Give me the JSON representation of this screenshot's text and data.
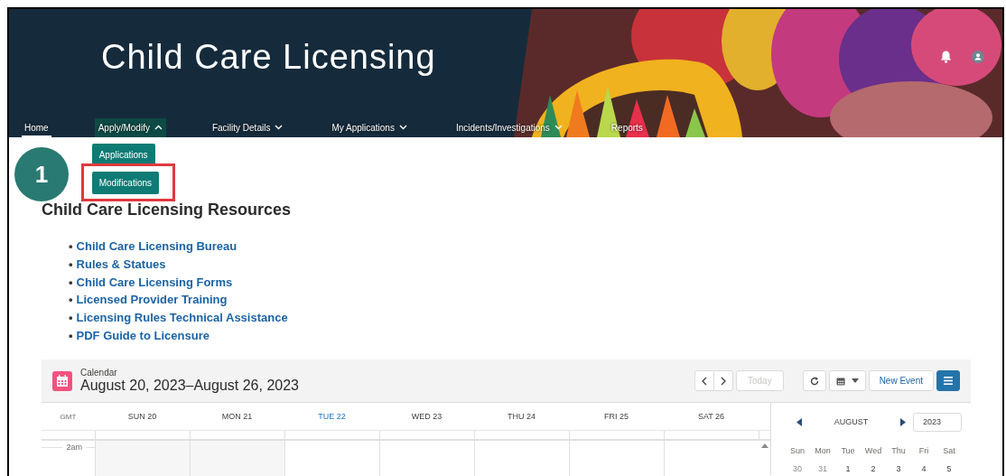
{
  "site_title": "Child Care Licensing",
  "nav": [
    {
      "label": "Home",
      "selected": true,
      "has_menu": false,
      "expanded": false
    },
    {
      "label": "Apply/Modify",
      "selected": false,
      "has_menu": true,
      "expanded": true,
      "menu": [
        {
          "label": "Applications",
          "annotated": false
        },
        {
          "label": "Modifications",
          "annotated": true
        }
      ]
    },
    {
      "label": "Facility Details",
      "selected": false,
      "has_menu": true,
      "expanded": false
    },
    {
      "label": "My Applications",
      "selected": false,
      "has_menu": true,
      "expanded": false
    },
    {
      "label": "Incidents/Investigations",
      "selected": false,
      "has_menu": true,
      "expanded": false
    },
    {
      "label": "Reports",
      "selected": false,
      "has_menu": false,
      "expanded": false
    }
  ],
  "step_badge": "1",
  "resources": {
    "title": "Child Care Licensing Resources",
    "links": [
      {
        "bullet": "•",
        "label": "Child Care Licensing Bureau"
      },
      {
        "bullet": "•",
        "label": "Rules & Statues"
      },
      {
        "bullet": "•",
        "label": "Child Care Licensing Forms"
      },
      {
        "bullet": "•",
        "label": "Licensed Provider Training"
      },
      {
        "bullet": "•",
        "label": "Licensing Rules Technical Assistance"
      },
      {
        "bullet": "•",
        "label": "PDF Guide to Licensure"
      }
    ]
  },
  "calendar": {
    "caption": "Calendar",
    "range": "August 20, 2023–August 26, 2023",
    "today_button": {
      "label": "Today",
      "disabled": true
    },
    "new_event": "New Event",
    "timezone": "GMT",
    "days": [
      {
        "label": "SUN 20",
        "today": false,
        "past": true
      },
      {
        "label": "MON 21",
        "today": false,
        "past": true
      },
      {
        "label": "TUE 22",
        "today": true,
        "past": false
      },
      {
        "label": "WED 23",
        "today": false,
        "past": false
      },
      {
        "label": "THU 24",
        "today": false,
        "past": false
      },
      {
        "label": "FRI 25",
        "today": false,
        "past": false
      },
      {
        "label": "SAT 26",
        "today": false,
        "past": false
      }
    ],
    "hours": [
      "2am"
    ],
    "mini": {
      "month": "AUGUST",
      "year": "2023",
      "weekdays": [
        "Sun",
        "Mon",
        "Tue",
        "Wed",
        "Thu",
        "Fri",
        "Sat"
      ],
      "dates": [
        {
          "label": "30",
          "outside": true
        },
        {
          "label": "31",
          "outside": true
        },
        {
          "label": "1",
          "outside": false
        },
        {
          "label": "2",
          "outside": false
        },
        {
          "label": "3",
          "outside": false
        },
        {
          "label": "4",
          "outside": false
        },
        {
          "label": "5",
          "outside": false
        }
      ]
    }
  }
}
